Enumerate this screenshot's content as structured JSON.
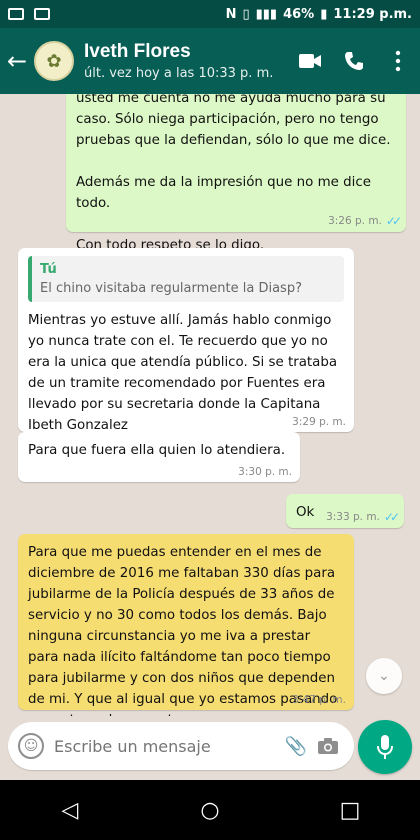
{
  "status_bar": {
    "battery": "46%",
    "time": "11:29 p.m."
  },
  "header": {
    "contact_name": "Iveth Flores",
    "last_seen": "últ. vez hoy a las 10:33 p. m."
  },
  "messages": [
    {
      "id": "m1",
      "direction": "out",
      "text": "usted me cuenta no me ayuda mucho para su caso. Sólo niega participación, pero no tengo pruebas que la defiendan, sólo lo que me dice.\n\nAdemás me da la impresión que no me dice todo.\n\nCon todo respeto se lo digo.",
      "time": "3:26 p. m.",
      "ticks": "✓✓"
    },
    {
      "id": "m2",
      "direction": "in",
      "quote_author": "Tú",
      "quote_text": "El chino visitaba regularmente la Diasp?",
      "text": "Mientras yo estuve allí. Jamás hablo conmigo yo nunca trate con el. Te recuerdo que yo no era la unica que atendía público. Si se trataba de un tramite recomendado por Fuentes era llevado por su secretaria donde la Capitana Ibeth Gonzalez",
      "time": "3:29 p. m."
    },
    {
      "id": "m3",
      "direction": "in",
      "text": "Para que fuera ella quien lo atendiera.",
      "time": "3:30 p. m."
    },
    {
      "id": "m4",
      "direction": "out",
      "text": "Ok",
      "time": "3:33 p. m.",
      "ticks": "✓✓"
    },
    {
      "id": "m5",
      "direction": "in-highlight",
      "text": "Para que me puedas entender en el mes de diciembre de 2016 me faltaban 330 días para jubilarme de la Policía después de 33 años de servicio y no 30 como todos los demás. Bajo ninguna circunstancia yo me iva a prestar para nada ilícito faltándome tan poco tiempo para jubilarme y con dos niños que dependen de mi. Y que al igual que yo estamos pasando por este mal momento",
      "time": "3:47 p. m."
    }
  ],
  "composer": {
    "placeholder": "Escribe un mensaje"
  },
  "colors": {
    "header": "#075e54",
    "status_bar": "#054d44",
    "outgoing_bubble": "#dcf8c6",
    "incoming_bubble": "#ffffff",
    "highlight_bubble": "#f6dd72",
    "accent": "#00a884",
    "read_ticks": "#4fc3f7",
    "chat_background": "#e5ddd5"
  },
  "icons": {
    "back": "arrow-left-icon",
    "video": "video-camera-icon",
    "call": "phone-icon",
    "menu": "more-vert-icon",
    "emoji": "emoji-icon",
    "attach": "paperclip-icon",
    "camera": "camera-icon",
    "mic": "microphone-icon",
    "scroll": "chevrons-down-icon"
  }
}
